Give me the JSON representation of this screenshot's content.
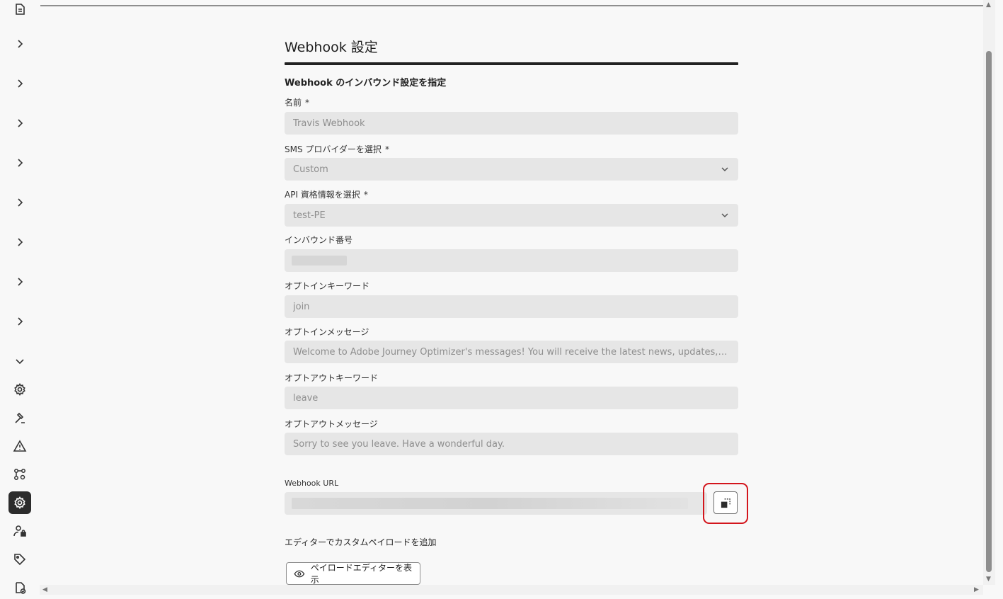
{
  "rail": {
    "items": [
      {
        "icon": "document-icon"
      },
      {
        "icon": "chevron-right-icon"
      },
      {
        "icon": "chevron-right-icon"
      },
      {
        "icon": "chevron-right-icon"
      },
      {
        "icon": "chevron-right-icon"
      },
      {
        "icon": "chevron-right-icon"
      },
      {
        "icon": "chevron-right-icon"
      },
      {
        "icon": "chevron-right-icon"
      },
      {
        "icon": "chevron-right-icon"
      },
      {
        "icon": "chevron-down-icon"
      },
      {
        "icon": "gear-icon"
      },
      {
        "icon": "hammer-icon"
      },
      {
        "icon": "alert-icon"
      },
      {
        "icon": "workflow-settings-icon"
      },
      {
        "icon": "gear-icon",
        "active": true
      },
      {
        "icon": "user-lock-icon"
      },
      {
        "icon": "tag-icon"
      },
      {
        "icon": "document-check-icon"
      }
    ]
  },
  "form": {
    "title": "Webhook 設定",
    "subheading": "Webhook のインバウンド設定を指定",
    "name": {
      "label": "名前",
      "required_mark": "*",
      "value": "Travis Webhook"
    },
    "sms_provider": {
      "label": "SMS プロバイダーを選択",
      "required_mark": "*",
      "value": "Custom"
    },
    "api_credentials": {
      "label": "API 資格情報を選択",
      "required_mark": "*",
      "value": "test-PE"
    },
    "inbound_number": {
      "label": "インバウンド番号",
      "value_hidden": true
    },
    "optin_keyword": {
      "label": "オプトインキーワード",
      "value": "join"
    },
    "optin_message": {
      "label": "オプトインメッセージ",
      "value": "Welcome to Adobe Journey Optimizer's messages! You will receive the latest news, updates, and informati..."
    },
    "optout_keyword": {
      "label": "オプトアウトキーワード",
      "value": "leave"
    },
    "optout_message": {
      "label": "オプトアウトメッセージ",
      "value": "Sorry to see you leave. Have a wonderful day."
    },
    "webhook_url": {
      "label": "Webhook URL",
      "value_hidden": true
    },
    "payload": {
      "label": "エディターでカスタムペイロードを追加",
      "button_label": "ペイロードエディターを表示"
    }
  },
  "colors": {
    "highlight": "#d3151c",
    "field_bg": "#e6e6e6",
    "active_rail": "#2c2c2c"
  }
}
